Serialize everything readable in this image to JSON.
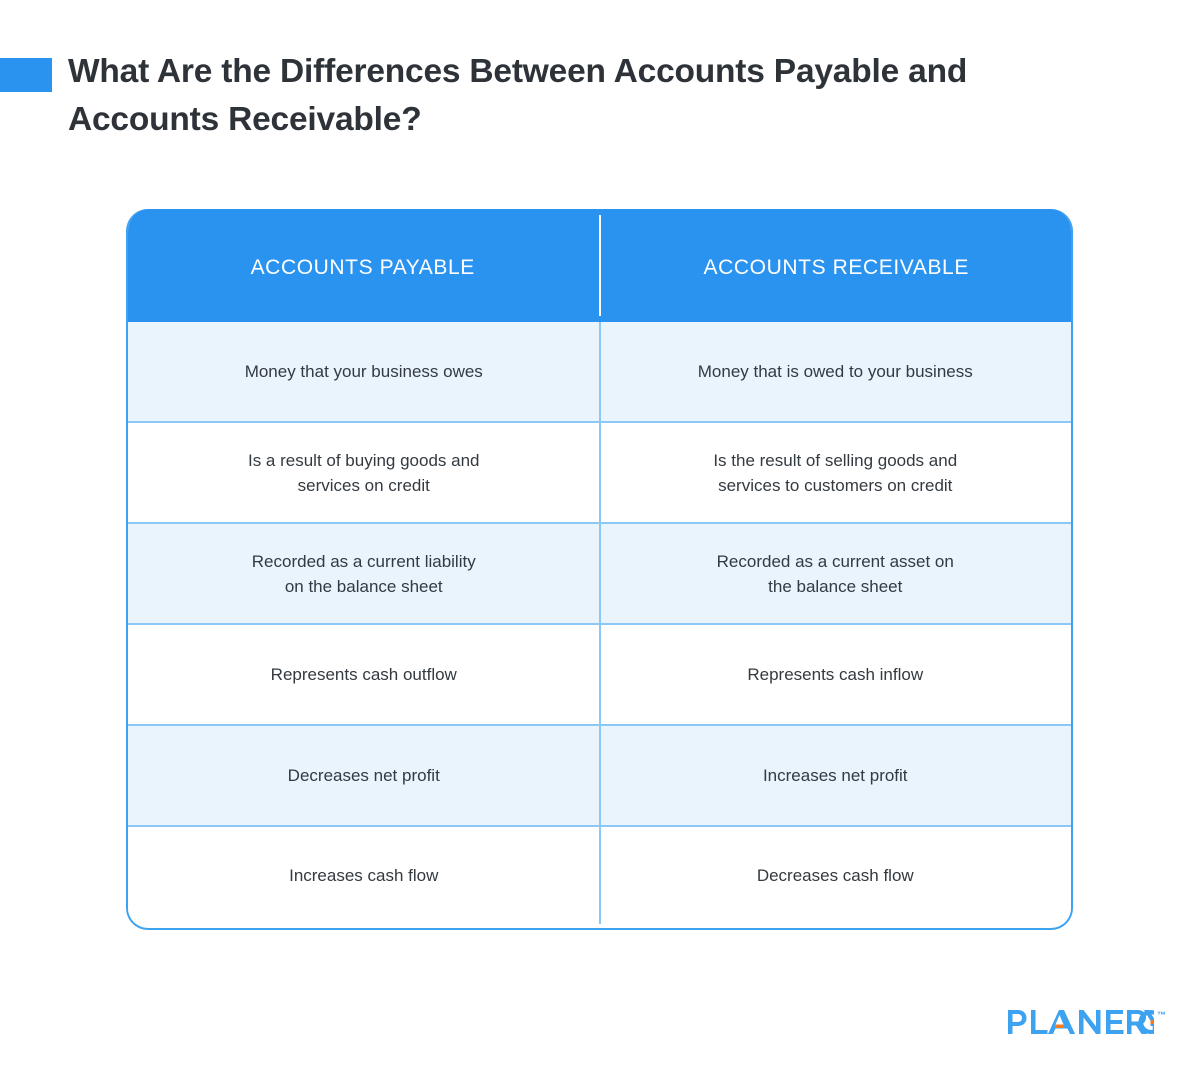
{
  "page": {
    "background": "#FFFFFF",
    "accent_color": "#2A93F0",
    "accent_light": "#EAF4FD",
    "divider_color": "#8CC8F5",
    "text_color": "#333A40",
    "title_color": "#2D3338",
    "logo_orange": "#F47B20"
  },
  "header": {
    "title": "What Are the Differences Between Accounts Payable and Accounts Receivable?"
  },
  "table": {
    "columns": [
      {
        "label": "ACCOUNTS PAYABLE"
      },
      {
        "label": "ACCOUNTS RECEIVABLE"
      }
    ],
    "rows": [
      {
        "payable": "Money that your business owes",
        "receivable": "Money that is owed to your business"
      },
      {
        "payable": "Is a result of buying goods and\nservices on credit",
        "receivable": "Is the result of selling goods and\nservices to customers on credit"
      },
      {
        "payable": "Recorded as a current liability\non the balance sheet",
        "receivable": "Recorded as a current asset on\nthe balance sheet"
      },
      {
        "payable": "Represents cash outflow",
        "receivable": "Represents cash inflow"
      },
      {
        "payable": "Decreases net profit",
        "receivable": "Increases net profit"
      },
      {
        "payable": "Increases cash flow",
        "receivable": "Decreases cash flow"
      }
    ]
  },
  "footer": {
    "logo_text": "PLANERGY",
    "trademark": "™"
  }
}
